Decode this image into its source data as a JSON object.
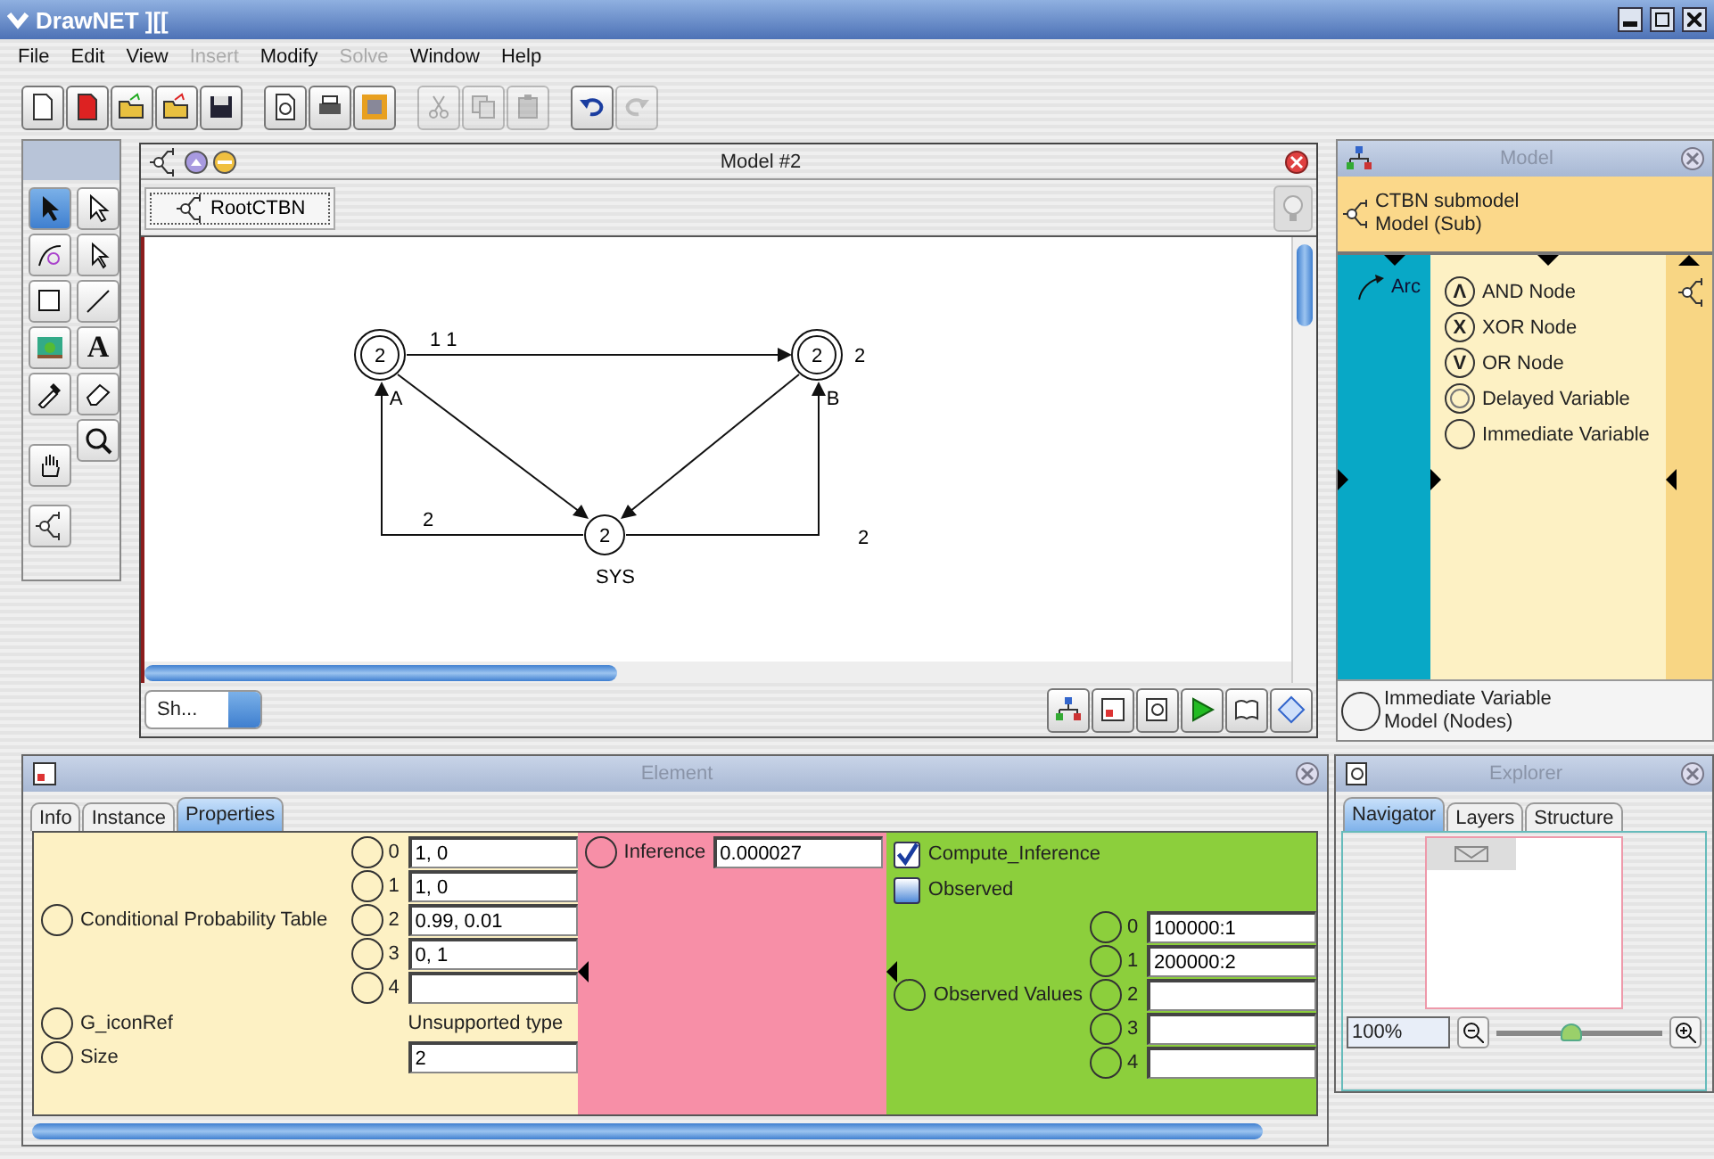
{
  "window": {
    "title": "DrawNET ][["
  },
  "menu": [
    {
      "label": "File",
      "disabled": false
    },
    {
      "label": "Edit",
      "disabled": false
    },
    {
      "label": "View",
      "disabled": false
    },
    {
      "label": "Insert",
      "disabled": true
    },
    {
      "label": "Modify",
      "disabled": false
    },
    {
      "label": "Solve",
      "disabled": true
    },
    {
      "label": "Window",
      "disabled": false
    },
    {
      "label": "Help",
      "disabled": false
    }
  ],
  "toolbar": [
    [
      {
        "kind": "new",
        "disabled": false
      },
      {
        "kind": "pdf",
        "disabled": false
      },
      {
        "kind": "open",
        "disabled": false
      },
      {
        "kind": "open-red",
        "disabled": false
      },
      {
        "kind": "save",
        "disabled": false
      }
    ],
    [
      {
        "kind": "preview",
        "disabled": false
      },
      {
        "kind": "print",
        "disabled": false
      },
      {
        "kind": "picture-tool",
        "disabled": false
      }
    ],
    [
      {
        "kind": "cut",
        "disabled": true
      },
      {
        "kind": "copy",
        "disabled": true
      },
      {
        "kind": "paste",
        "disabled": true
      }
    ],
    [
      {
        "kind": "undo",
        "disabled": false
      },
      {
        "kind": "redo",
        "disabled": true
      }
    ]
  ],
  "palette": [
    {
      "kind": "pointer",
      "selected": true
    },
    {
      "kind": "pointer-sub",
      "selected": false
    },
    {
      "kind": "arc",
      "selected": false
    },
    {
      "kind": "arc-sub",
      "selected": false
    },
    {
      "kind": "rectangle",
      "selected": false
    },
    {
      "kind": "line",
      "selected": false
    },
    {
      "kind": "image",
      "selected": false
    },
    {
      "kind": "text",
      "symbol": "A",
      "selected": false
    },
    {
      "kind": "eyedropper",
      "selected": false
    },
    {
      "kind": "eraser",
      "selected": false
    },
    {
      "kind": "hand",
      "selected": false
    },
    {
      "kind": "zoom",
      "selected": false
    },
    {
      "kind": "submodel",
      "selected": false
    }
  ],
  "model_window": {
    "title": "Model #2",
    "breadcrumb": "RootCTBN",
    "nodes": [
      {
        "kind": "delayed",
        "value": "2",
        "name": "A"
      },
      {
        "kind": "delayed",
        "value": "2",
        "name": "B"
      },
      {
        "kind": "immediate",
        "value": "2",
        "name": "SYS"
      }
    ],
    "arc_labels": [
      "1 1",
      "2",
      "2",
      "2"
    ],
    "view_select": "Sh..."
  },
  "model_panel": {
    "title": "Model",
    "submodel": {
      "name": "CTBN submodel",
      "type": "Model (Sub)"
    },
    "arc": "Arc",
    "node_types": [
      {
        "kind": "and",
        "symbol": "Λ",
        "label": "AND Node"
      },
      {
        "kind": "xor",
        "symbol": "X",
        "label": "XOR Node"
      },
      {
        "kind": "or",
        "symbol": "V",
        "label": "OR Node"
      },
      {
        "kind": "delayed",
        "label": "Delayed Variable"
      },
      {
        "kind": "immediate",
        "label": "Immediate Variable"
      }
    ],
    "selection": {
      "name": "Immediate Variable",
      "type": "Model (Nodes)"
    }
  },
  "element_panel": {
    "title": "Element",
    "tabs": [
      {
        "label": "Info",
        "selected": false
      },
      {
        "label": "Instance",
        "selected": false
      },
      {
        "label": "Properties",
        "selected": true
      }
    ],
    "cpt": {
      "label": "Conditional Probability Table",
      "entries": [
        {
          "index": "0",
          "value": "1, 0"
        },
        {
          "index": "1",
          "value": "1, 0"
        },
        {
          "index": "2",
          "value": "0.99, 0.01"
        },
        {
          "index": "3",
          "value": "0, 1"
        },
        {
          "index": "4"
        }
      ]
    },
    "icon_ref": {
      "label": "G_iconRef",
      "value": "Unsupported type"
    },
    "size": {
      "label": "Size",
      "value": "2"
    },
    "inference": {
      "label": "Inference",
      "value": "0.000027"
    },
    "compute_inference": {
      "label": "Compute_Inference",
      "checked": true
    },
    "observed": {
      "label": "Observed",
      "checked": false
    },
    "observed_values": {
      "label": "Observed Values",
      "entries": [
        {
          "index": "0",
          "value": "100000:1"
        },
        {
          "index": "1",
          "value": "200000:2"
        },
        {
          "index": "2"
        },
        {
          "index": "3"
        },
        {
          "index": "4"
        }
      ]
    }
  },
  "explorer": {
    "title": "Explorer",
    "tabs": [
      {
        "label": "Navigator",
        "selected": true
      },
      {
        "label": "Layers",
        "selected": false
      },
      {
        "label": "Structure",
        "selected": false
      }
    ],
    "zoom": "100%",
    "zoom_slider": {
      "level": 0.45
    }
  }
}
